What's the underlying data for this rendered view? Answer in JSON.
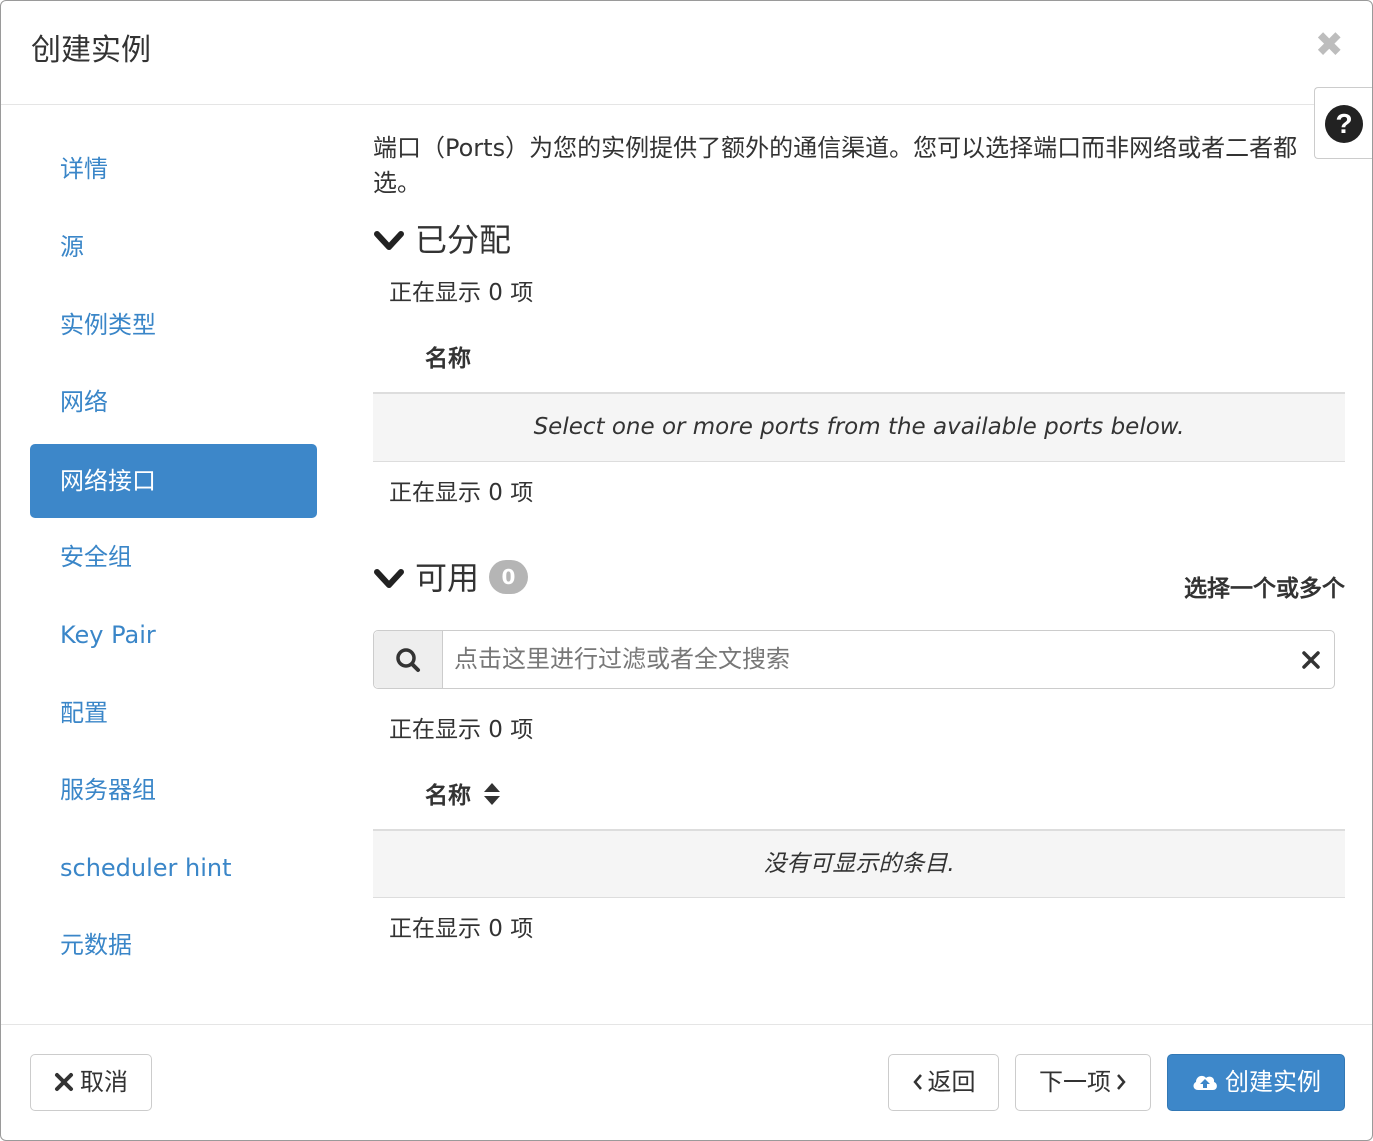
{
  "dialog": {
    "title": "创建实例",
    "close_symbol": "✖",
    "help_symbol": "?"
  },
  "sidebar": {
    "items": [
      {
        "label": "详情"
      },
      {
        "label": "源"
      },
      {
        "label": "实例类型"
      },
      {
        "label": "网络"
      },
      {
        "label": "网络接口",
        "active": true
      },
      {
        "label": "安全组"
      },
      {
        "label": "Key Pair"
      },
      {
        "label": "配置"
      },
      {
        "label": "服务器组"
      },
      {
        "label": "scheduler hint"
      },
      {
        "label": "元数据"
      }
    ]
  },
  "main": {
    "description": "端口（Ports）为您的实例提供了额外的通信渠道。您可以选择端口而非网络或者二者都选。",
    "allocated": {
      "title": "已分配",
      "count_top": "正在显示 0 项",
      "column_name": "名称",
      "empty_message": "Select one or more ports from the available ports below.",
      "count_bottom": "正在显示 0 项"
    },
    "available": {
      "title": "可用",
      "badge": "0",
      "select_hint": "选择一个或多个",
      "search_placeholder": "点击这里进行过滤或者全文搜索",
      "count_top": "正在显示 0 项",
      "column_name": "名称",
      "empty_message": "没有可显示的条目.",
      "count_bottom": "正在显示 0 项"
    }
  },
  "footer": {
    "cancel_label": "取消",
    "back_label": "返回",
    "next_label": "下一项",
    "create_label": "创建实例"
  },
  "colors": {
    "primary": "#3d87c9",
    "link": "#3a86c8",
    "badge": "#b5b5b5"
  },
  "icons": [
    "close-icon",
    "help-icon",
    "chevron-down-icon",
    "search-icon",
    "clear-icon",
    "sort-icon",
    "times-icon",
    "chevron-left-icon",
    "chevron-right-icon",
    "cloud-upload-icon"
  ]
}
